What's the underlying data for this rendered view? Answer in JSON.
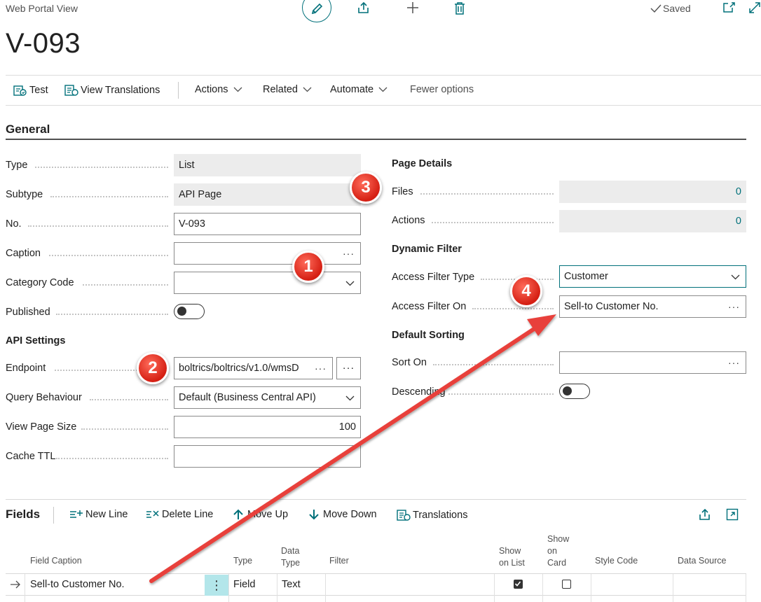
{
  "header": {
    "breadcrumb": "Web Portal View",
    "title": "V-093",
    "saved_label": "Saved"
  },
  "actionbar": {
    "test": "Test",
    "view_translations": "View Translations",
    "actions": "Actions",
    "related": "Related",
    "automate": "Automate",
    "fewer_options": "Fewer options"
  },
  "general": {
    "title": "General",
    "type": {
      "label": "Type",
      "value": "List"
    },
    "subtype": {
      "label": "Subtype",
      "value": "API Page"
    },
    "no": {
      "label": "No.",
      "value": "V-093"
    },
    "caption": {
      "label": "Caption",
      "value": ""
    },
    "category_code": {
      "label": "Category Code",
      "value": ""
    },
    "published": {
      "label": "Published",
      "value": false
    },
    "api_settings_title": "API Settings",
    "endpoint": {
      "label": "Endpoint",
      "value": "boltrics/boltrics/v1.0/wmsD"
    },
    "query_behaviour": {
      "label": "Query Behaviour",
      "value": "Default (Business Central API)"
    },
    "view_page_size": {
      "label": "View Page Size",
      "value": "100"
    },
    "cache_ttl": {
      "label": "Cache TTL",
      "value": ""
    }
  },
  "page_details": {
    "title": "Page Details",
    "files": {
      "label": "Files",
      "value": "0"
    },
    "actions": {
      "label": "Actions",
      "value": "0"
    },
    "dynamic_filter_title": "Dynamic Filter",
    "access_filter_type": {
      "label": "Access Filter Type",
      "value": "Customer"
    },
    "access_filter_on": {
      "label": "Access Filter On",
      "value": "Sell-to Customer No."
    },
    "default_sorting_title": "Default Sorting",
    "sort_on": {
      "label": "Sort On",
      "value": ""
    },
    "descending": {
      "label": "Descending",
      "value": false
    }
  },
  "badges": [
    "1",
    "2",
    "3",
    "4"
  ],
  "fields": {
    "title": "Fields",
    "new_line": "New Line",
    "delete_line": "Delete Line",
    "move_up": "Move Up",
    "move_down": "Move Down",
    "translations": "Translations",
    "columns": {
      "field_caption": "Field Caption",
      "type": "Type",
      "data_type_1": "Data",
      "data_type_2": "Type",
      "filter": "Filter",
      "show_on_list_1": "Show",
      "show_on_list_2": "on List",
      "show_on_card_1": "Show",
      "show_on_card_2": "on",
      "show_on_card_3": "Card",
      "style_code": "Style Code",
      "data_source": "Data Source"
    },
    "rows": [
      {
        "field_caption": "Sell-to Customer No.",
        "type": "Field",
        "data_type": "Text",
        "filter": "",
        "show_on_list": true,
        "show_on_card": false,
        "style_code": "",
        "data_source": ""
      }
    ]
  },
  "colors": {
    "accent": "#00707a",
    "badge": "#e0281c",
    "arrow": "#e8413a"
  }
}
